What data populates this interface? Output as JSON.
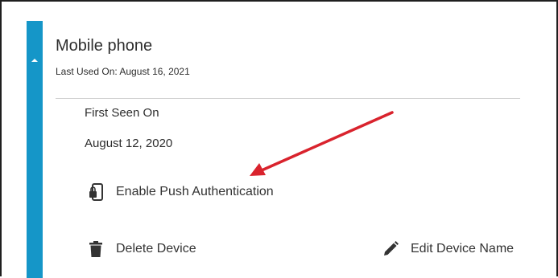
{
  "device": {
    "title": "Mobile phone",
    "last_used": "Last Used On: August 16, 2021",
    "first_seen_label": "First Seen On",
    "first_seen_value": "August 12, 2020"
  },
  "actions": {
    "enable_push": {
      "label": "Enable Push Authentication",
      "icon": "phone-lock-icon"
    },
    "delete_device": {
      "label": "Delete Device",
      "icon": "trash-icon"
    },
    "edit_name": {
      "label": "Edit Device Name",
      "icon": "pencil-icon"
    }
  },
  "colors": {
    "accent": "#1596c8",
    "annotation_arrow": "#d9232d",
    "text": "#2d2d2d",
    "divider": "#cfcfcf"
  }
}
